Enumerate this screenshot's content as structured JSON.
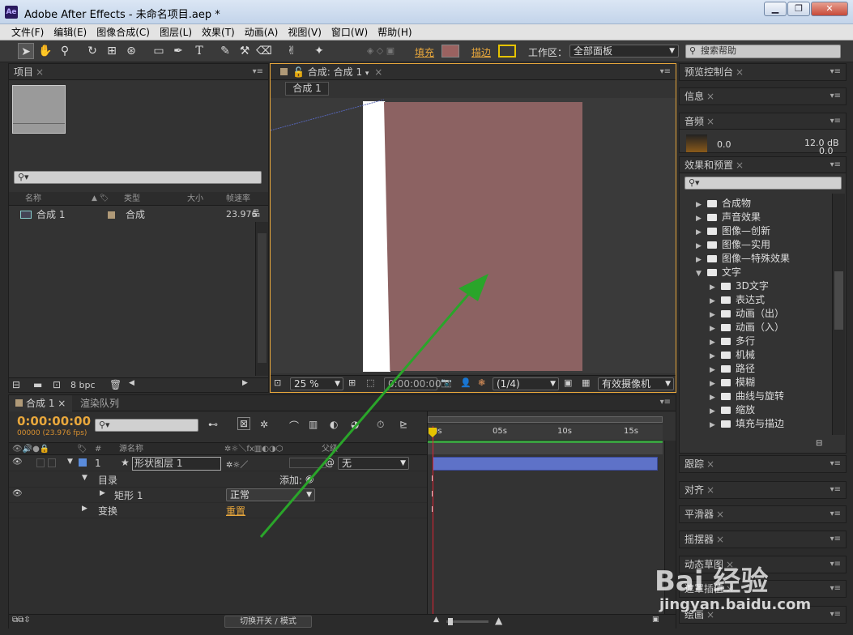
{
  "window": {
    "title": "Adobe After Effects - 未命名项目.aep *",
    "app_logo": "Ae",
    "minimize": "▁",
    "restore": "❐",
    "close": "✕"
  },
  "menu": [
    "文件(F)",
    "编辑(E)",
    "图像合成(C)",
    "图层(L)",
    "效果(T)",
    "动画(A)",
    "视图(V)",
    "窗口(W)",
    "帮助(H)"
  ],
  "toolbar": {
    "fill_label": "填充",
    "stroke_label": "描边",
    "workspace_label": "工作区：",
    "workspace_value": "全部面板",
    "search_placeholder": "搜索帮助",
    "fill_color": "#9a6260",
    "stroke_color": "#e6c300"
  },
  "project": {
    "tab": "项目",
    "columns": [
      "名称",
      "类型",
      "大小",
      "帧速率"
    ],
    "items": [
      {
        "name": "合成 1",
        "type": "合成",
        "fps": "23.976"
      }
    ],
    "bpc": "8 bpc"
  },
  "viewer": {
    "tab": "合成: 合成 1",
    "subtab": "合成 1",
    "zoom": "25 %",
    "timecode": "0:00:00:00",
    "resolution": "(1/4)",
    "camera": "有效摄像机",
    "layer_color": "#8c6262"
  },
  "right_panels": {
    "preview": "预览控制台",
    "info": "信息",
    "audio": "音频",
    "audio_values": [
      "0.0",
      "12.0 dB",
      "0.0"
    ],
    "effects": "效果和预置",
    "effects_items": [
      {
        "label": "合成物",
        "level": 0,
        "open": false
      },
      {
        "label": "声音效果",
        "level": 0,
        "open": false
      },
      {
        "label": "图像—创新",
        "level": 0,
        "open": false
      },
      {
        "label": "图像—实用",
        "level": 0,
        "open": false
      },
      {
        "label": "图像—特殊效果",
        "level": 0,
        "open": false
      },
      {
        "label": "文字",
        "level": 0,
        "open": true
      },
      {
        "label": "3D文字",
        "level": 1,
        "open": false
      },
      {
        "label": "表达式",
        "level": 1,
        "open": false
      },
      {
        "label": "动画（出）",
        "level": 1,
        "open": false
      },
      {
        "label": "动画（入）",
        "level": 1,
        "open": false
      },
      {
        "label": "多行",
        "level": 1,
        "open": false
      },
      {
        "label": "机械",
        "level": 1,
        "open": false
      },
      {
        "label": "路径",
        "level": 1,
        "open": false
      },
      {
        "label": "模糊",
        "level": 1,
        "open": false
      },
      {
        "label": "曲线与旋转",
        "level": 1,
        "open": false
      },
      {
        "label": "缩放",
        "level": 1,
        "open": false
      },
      {
        "label": "填充与描边",
        "level": 1,
        "open": false
      }
    ],
    "tracker": "跟踪",
    "align": "对齐",
    "smoother": "平滑器",
    "wiggler": "摇摆器",
    "motion_sketch": "动态草图",
    "mask_interp": "遮罩插值",
    "paint": "绘画"
  },
  "timeline": {
    "tab": "合成 1",
    "render_tab": "渲染队列",
    "timecode": "0:00:00:00",
    "fps_info": "00000 (23.976 fps)",
    "col_source": "源名称",
    "col_parent": "父级",
    "layer": {
      "num": "1",
      "name": "形状图层 1",
      "parent": "无",
      "color": "#5a8cdc"
    },
    "contents": "目录",
    "add": "添加:",
    "rect": "矩形 1",
    "blend": "正常",
    "transform": "变换",
    "reset": "重置",
    "ruler": [
      "0s",
      "05s",
      "10s",
      "15s"
    ],
    "switch_modes": "切换开关 / 模式"
  },
  "watermark": {
    "text": "Bai 经验",
    "url": "jingyan.baidu.com"
  },
  "arrow_color": "#2aa52a"
}
